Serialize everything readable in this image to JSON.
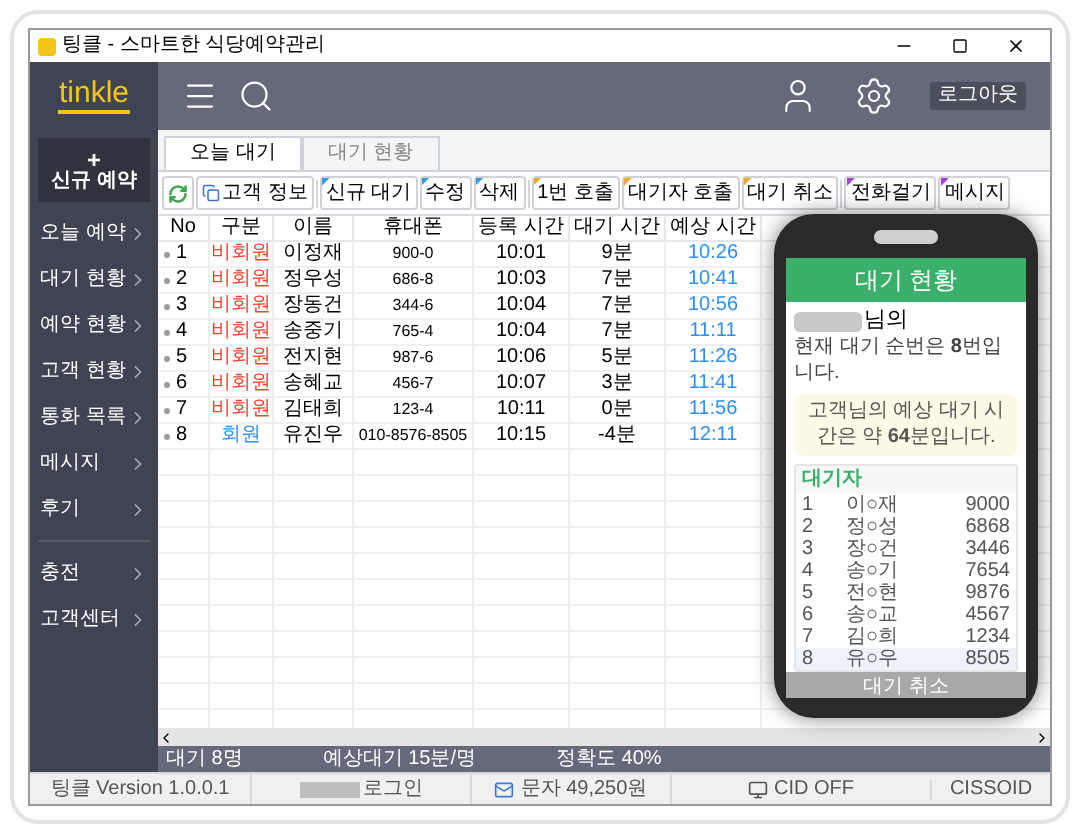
{
  "window": {
    "title": "팅클 - 스마트한 식당예약관리"
  },
  "header": {
    "logo": "tinkle",
    "logout_button": "로그아웃"
  },
  "sidebar": {
    "new_button": {
      "icon": "+",
      "label": "신규 예약"
    },
    "items": [
      {
        "label": "오늘 예약"
      },
      {
        "label": "대기 현황"
      },
      {
        "label": "예약 현황"
      },
      {
        "label": "고객 현황"
      },
      {
        "label": "통화 목록"
      },
      {
        "label": "메시지"
      },
      {
        "label": "후기"
      }
    ],
    "bottom_items": [
      {
        "label": "충전"
      },
      {
        "label": "고객센터"
      }
    ]
  },
  "tabs": [
    {
      "label": "오늘 대기",
      "selected": true
    },
    {
      "label": "대기 현황",
      "selected": false
    }
  ],
  "toolbar": [
    {
      "kind": "refresh"
    },
    {
      "kind": "info",
      "label": "고객 정보"
    },
    {
      "kind": "action",
      "label": "신규 대기",
      "color": "#2f9be8"
    },
    {
      "kind": "action",
      "label": "수정",
      "color": "#2f9be8"
    },
    {
      "kind": "action",
      "label": "삭제",
      "color": "#2f9be8"
    },
    {
      "kind": "action",
      "label": "1번 호출",
      "color": "#f5a623"
    },
    {
      "kind": "action",
      "label": "대기자 호출",
      "color": "#f5a623"
    },
    {
      "kind": "action",
      "label": "대기 취소",
      "color": "#f5a623"
    },
    {
      "kind": "action",
      "label": "전화걸기",
      "color": "#a23fe0"
    },
    {
      "kind": "action",
      "label": "메시지",
      "color": "#a23fe0"
    }
  ],
  "table": {
    "columns": [
      "No",
      "구분",
      "이름",
      "휴대폰",
      "등록 시간",
      "대기 시간",
      "예상 시간"
    ],
    "rows": [
      {
        "no": "1",
        "kind": "non_member",
        "type": "비회원",
        "name": "이정재",
        "phone": "900-0",
        "registered": "10:01",
        "wait": "9분",
        "expected": "10:26"
      },
      {
        "no": "2",
        "kind": "non_member",
        "type": "비회원",
        "name": "정우성",
        "phone": "686-8",
        "registered": "10:03",
        "wait": "7분",
        "expected": "10:41"
      },
      {
        "no": "3",
        "kind": "non_member",
        "type": "비회원",
        "name": "장동건",
        "phone": "344-6",
        "registered": "10:04",
        "wait": "7분",
        "expected": "10:56"
      },
      {
        "no": "4",
        "kind": "non_member",
        "type": "비회원",
        "name": "송중기",
        "phone": "765-4",
        "registered": "10:04",
        "wait": "7분",
        "expected": "11:11"
      },
      {
        "no": "5",
        "kind": "non_member",
        "type": "비회원",
        "name": "전지현",
        "phone": "987-6",
        "registered": "10:06",
        "wait": "5분",
        "expected": "11:26"
      },
      {
        "no": "6",
        "kind": "non_member",
        "type": "비회원",
        "name": "송혜교",
        "phone": "456-7",
        "registered": "10:07",
        "wait": "3분",
        "expected": "11:41"
      },
      {
        "no": "7",
        "kind": "non_member",
        "type": "비회원",
        "name": "김태희",
        "phone": "123-4",
        "registered": "10:11",
        "wait": "0분",
        "expected": "11:56"
      },
      {
        "no": "8",
        "kind": "member",
        "type": "회원",
        "name": "유진우",
        "phone": "010-8576-8505",
        "registered": "10:15",
        "wait": "-4분",
        "expected": "12:11"
      }
    ]
  },
  "summary": [
    "대기 8명",
    "예상대기 15분/명",
    "정확도 40%"
  ],
  "status_bar": {
    "version": "팅클 Version 1.0.0.1",
    "login": "로그인",
    "sms": "문자 49,250원",
    "cid": "CID OFF",
    "brand": "CISSOID"
  },
  "phone": {
    "title": "대기 현황",
    "name_suffix": "님의",
    "order_text": "현재 대기 순번은 **8**번입니다.",
    "notice": "고객님의 예상 대기 시간은 약 **64**분입니다.",
    "list_title": "대기자",
    "list": [
      {
        "no": "1",
        "name": "이○재",
        "phone": "9000",
        "selected": false
      },
      {
        "no": "2",
        "name": "정○성",
        "phone": "6868",
        "selected": false
      },
      {
        "no": "3",
        "name": "장○건",
        "phone": "3446",
        "selected": false
      },
      {
        "no": "4",
        "name": "송○기",
        "phone": "7654",
        "selected": false
      },
      {
        "no": "5",
        "name": "전○현",
        "phone": "9876",
        "selected": false
      },
      {
        "no": "6",
        "name": "송○교",
        "phone": "4567",
        "selected": false
      },
      {
        "no": "7",
        "name": "김○희",
        "phone": "1234",
        "selected": false
      },
      {
        "no": "8",
        "name": "유○우",
        "phone": "8505",
        "selected": true
      }
    ],
    "cancel_button": {
      "label": "대기 취소",
      "disabled": true
    }
  }
}
